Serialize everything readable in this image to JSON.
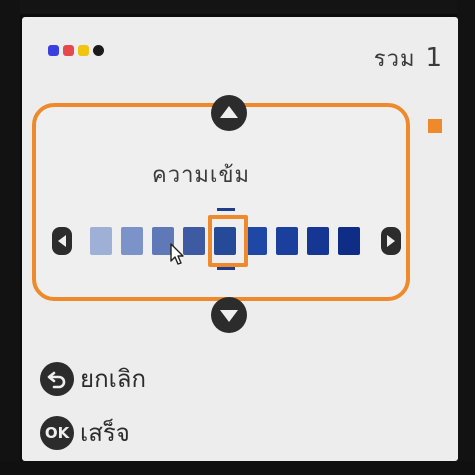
{
  "header": {
    "total_label": "รวม",
    "total_count": "1",
    "ink_colors": [
      "#3b3fe0",
      "#e5484d",
      "#f1c40f",
      "#1a1a1a"
    ]
  },
  "density": {
    "title": "ความเข้ม",
    "levels": 9,
    "selected_index": 4,
    "level_colors": [
      "#9fb0d6",
      "#7c93c9",
      "#5f78b8",
      "#3e5aa3",
      "#244a98",
      "#1e47a6",
      "#1a3f9c",
      "#153692",
      "#0f2c87"
    ]
  },
  "footer": {
    "cancel_label": "ยกเลิก",
    "ok_button": "OK",
    "done_label": "เสร็จ"
  },
  "colors": {
    "accent": "#ef8a2c",
    "screen_bg": "#ededed",
    "icon_dark": "#2c2c2c"
  }
}
